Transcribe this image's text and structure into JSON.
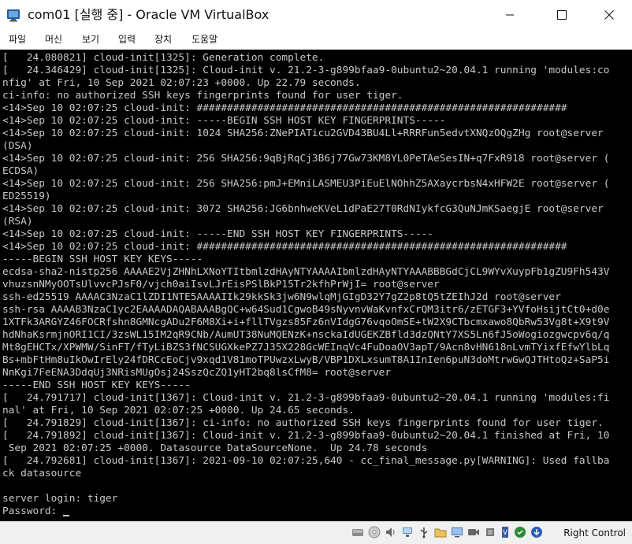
{
  "window": {
    "title": "com01 [실행 중] - Oracle VM VirtualBox",
    "minimize_symbol": "—",
    "maximize_symbol": "☐",
    "close_symbol": "✕"
  },
  "menubar": {
    "items": [
      "파일",
      "머신",
      "보기",
      "입력",
      "장치",
      "도움말"
    ]
  },
  "console": {
    "lines": [
      "[   24.080821] cloud-init[1325]: Generation complete.",
      "[   24.346429] cloud-init[1325]: Cloud-init v. 21.2-3-g899bfaa9-0ubuntu2~20.04.1 running 'modules:co",
      "nfig' at Fri, 10 Sep 2021 02:07:23 +0000. Up 22.79 seconds.",
      "ci-info: no authorized SSH keys fingerprints found for user tiger.",
      "<14>Sep 10 02:07:25 cloud-init: #############################################################",
      "<14>Sep 10 02:07:25 cloud-init: -----BEGIN SSH HOST KEY FINGERPRINTS-----",
      "<14>Sep 10 02:07:25 cloud-init: 1024 SHA256:ZNePIATicu2GVD43BU4Ll+RRRFun5edvtXNQzOQgZHg root@server",
      "(DSA)",
      "<14>Sep 10 02:07:25 cloud-init: 256 SHA256:9qBjRqCj3B6j77Gw73KM8YL0PeTAeSesIN+q7FxR918 root@server (",
      "ECDSA)",
      "<14>Sep 10 02:07:25 cloud-init: 256 SHA256:pmJ+EMniLASMEU3PiEuElNOhhZ5AXaycrbsN4xHFW2E root@server (",
      "ED25519)",
      "<14>Sep 10 02:07:25 cloud-init: 3072 SHA256:JG6bnhweKVeL1dPaE27T0RdNIykfcG3QuNJmKSaegjE root@server",
      "(RSA)",
      "<14>Sep 10 02:07:25 cloud-init: -----END SSH HOST KEY FINGERPRINTS-----",
      "<14>Sep 10 02:07:25 cloud-init: #############################################################",
      "-----BEGIN SSH HOST KEY KEYS-----",
      "ecdsa-sha2-nistp256 AAAAE2VjZHNhLXNoYTItbmlzdHAyNTYAAAAIbmlzdHAyNTYAAABBBGdCjCL9WYvXuypFb1gZU9Fh543V",
      "vhuzsnNMyOOTsUlvvcPJsF0/vjch0aiIsvLJrEisPSlBkP15Tr2kfhPrWjI= root@server",
      "ssh-ed25519 AAAAC3NzaC1lZDI1NTE5AAAAIIk29kkSk3jw6N9wlqMjGIgD32Y7gZ2p8tQ5tZEIhJ2d root@server",
      "ssh-rsa AAAAB3NzaC1yc2EAAAADAQABAAABgQC+w64Sud1CgwoB49sNyvnvWaKvnfxCrQM3itr6/zETGF3+YVfoHsijtCt0+d0e",
      "1XTFk3ARGYZ46FOCRfshn8GMNcgADu2F6M8Xi+i+fllTVgzs85Fz6nVIdgG76vqoOmSE+tW2X9CTbcmxawo8QbRw53Vg8t+X9t9V",
      "hdNhaKsrmjnORI1CI/3zsWL15IM2qR9CNb/AumUT38NuMQENzK+nsckaIdUGEKZBfld3dzQNtY7XS5Ln6fJ5oWogiozgwcpv6q/q",
      "Mt8gEHCTx/XPWMW/SinFT/fTyLiBZS3fNCSUGXkePZ7J35X228GcWEInqVc4FuDoaOV3apT/9Acn8vHN618nLvmTYixfEfwYlbLq",
      "Bs+mbFtHm8uIkOwIrEly24fDRCcEoCjv9xqd1V81moTPUwzxLwyB/VBP1DXLxsumT8A1InIen6puN3doMtrwGwQJTHtoQz+SaP5i",
      "NnKgi7FeENA3DdqUj3NRisMUgOsj24SszQcZQ1yHT2bq8lsCfM8= root@server",
      "-----END SSH HOST KEY KEYS-----",
      "[   24.791717] cloud-init[1367]: Cloud-init v. 21.2-3-g899bfaa9-0ubuntu2~20.04.1 running 'modules:fi",
      "nal' at Fri, 10 Sep 2021 02:07:25 +0000. Up 24.65 seconds.",
      "[   24.791829] cloud-init[1367]: ci-info: no authorized SSH keys fingerprints found for user tiger.",
      "[   24.791892] cloud-init[1367]: Cloud-init v. 21.2-3-g899bfaa9-0ubuntu2~20.04.1 finished at Fri, 10",
      " Sep 2021 02:07:25 +0000. Datasource DataSourceNone.  Up 24.78 seconds",
      "[   24.792681] cloud-init[1367]: 2021-09-10 02:07:25,640 - cc_final_message.py[WARNING]: Used fallba",
      "ck datasource",
      "",
      "server login: tiger"
    ],
    "prompt": "Password: "
  },
  "statusbar": {
    "icons": [
      "hard-disk-icon",
      "optical-disk-icon",
      "audio-icon",
      "network-icon",
      "usb-icon",
      "shared-folders-icon",
      "display-icon",
      "video-capture-icon",
      "cpu-icon",
      "mouse-integration-icon",
      "keyboard-capture-icon"
    ],
    "host_key": "Right Control"
  },
  "colors": {
    "console_bg": "#000000",
    "console_fg": "#c8c8c8",
    "statusbar_bg": "#f0f0f0"
  }
}
